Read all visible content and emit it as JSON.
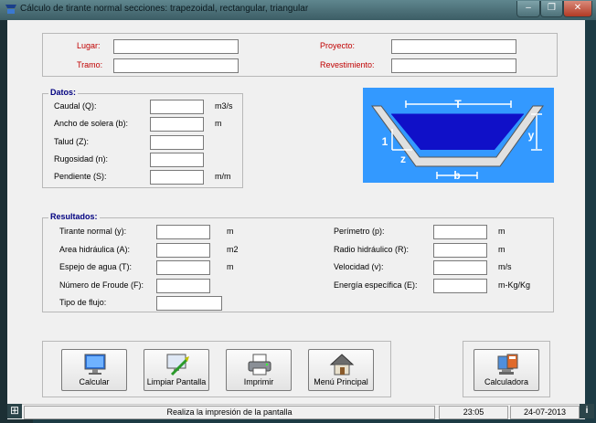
{
  "window": {
    "title": "Cálculo de tirante normal secciones: trapezoidal, rectangular, triangular",
    "min_glyph": "–",
    "max_glyph": "❐",
    "close_glyph": "✕"
  },
  "project": {
    "lugar_label": "Lugar:",
    "tramo_label": "Tramo:",
    "proyecto_label": "Proyecto:",
    "revestimiento_label": "Revestimiento:",
    "lugar_value": "",
    "tramo_value": "",
    "proyecto_value": "",
    "revestimiento_value": ""
  },
  "datos": {
    "legend": "Datos:",
    "caudal_label": "Caudal (Q):",
    "caudal_unit": "m3/s",
    "solera_label": "Ancho de solera (b):",
    "solera_unit": "m",
    "talud_label": "Talud (Z):",
    "rugosidad_label": "Rugosidad (n):",
    "pendiente_label": "Pendiente (S):",
    "pendiente_unit": "m/m",
    "caudal_value": "",
    "solera_value": "",
    "talud_value": "",
    "rugosidad_value": "",
    "pendiente_value": ""
  },
  "diagram": {
    "label_T": "T",
    "label_y": "y",
    "label_1": "1",
    "label_z": "z",
    "label_b": "b"
  },
  "resultados": {
    "legend": "Resultados:",
    "tirante_label": "Tirante normal (y):",
    "tirante_unit": "m",
    "area_label": "Area hidráulica (A):",
    "area_unit": "m2",
    "espejo_label": "Espejo de agua (T):",
    "espejo_unit": "m",
    "froude_label": "Número de Froude (F):",
    "tipo_label": "Tipo de flujo:",
    "perimetro_label": "Perímetro (p):",
    "perimetro_unit": "m",
    "radio_label": "Radio hidráulico (R):",
    "radio_unit": "m",
    "velocidad_label": "Velocidad (v):",
    "velocidad_unit": "m/s",
    "energia_label": "Energía específica (E):",
    "energia_unit": "m-Kg/Kg"
  },
  "buttons": {
    "calcular": "Calcular",
    "limpiar": "Limpiar Pantalla",
    "imprimir": "Imprimir",
    "menu": "Menú Principal",
    "calculadora": "Calculadora"
  },
  "status": {
    "message": "Realiza la impresión de la pantalla",
    "time": "23:05",
    "date": "24-07-2013"
  },
  "colors": {
    "accent_blue": "#3399ff",
    "label_red": "#c00000",
    "legend_navy": "#000080"
  }
}
